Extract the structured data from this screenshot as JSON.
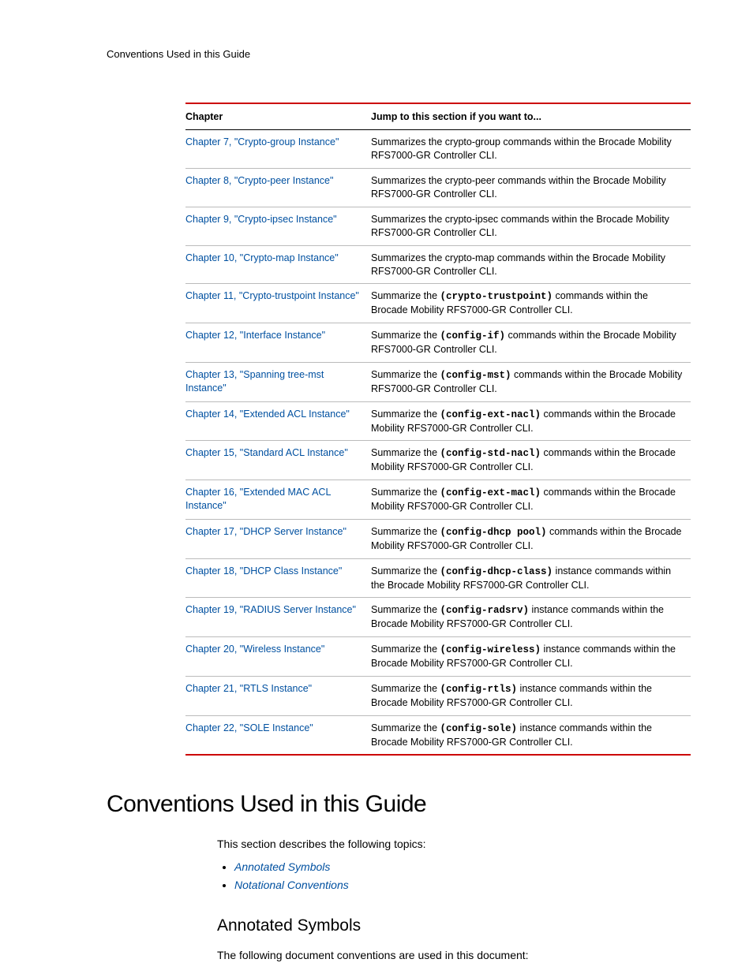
{
  "running_header": "Conventions Used in this Guide",
  "table": {
    "head_chapter": "Chapter",
    "head_desc": "Jump to this section if you want to...",
    "rows": [
      {
        "link": "Chapter 7, \"Crypto-group Instance\"",
        "desc": "Summarizes the crypto-group commands within the Brocade Mobility RFS7000-GR Controller CLI."
      },
      {
        "link": "Chapter 8, \"Crypto-peer Instance\"",
        "desc": "Summarizes the crypto-peer commands within the Brocade Mobility RFS7000-GR Controller CLI."
      },
      {
        "link": "Chapter 9, \"Crypto-ipsec Instance\"",
        "desc": "Summarizes the crypto-ipsec commands within the Brocade Mobility RFS7000-GR Controller CLI."
      },
      {
        "link": "Chapter 10, \"Crypto-map Instance\"",
        "desc": "Summarizes the crypto-map commands within the Brocade Mobility RFS7000-GR Controller CLI."
      },
      {
        "link": "Chapter 11, \"Crypto-trustpoint Instance\"",
        "pre": "Summarize the ",
        "code": "(crypto-trustpoint)",
        "post": " commands within the Brocade Mobility RFS7000-GR Controller CLI."
      },
      {
        "link": "Chapter 12, \"Interface Instance\"",
        "pre": "Summarize the ",
        "code": "(config-if)",
        "post": " commands within the Brocade Mobility RFS7000-GR Controller CLI."
      },
      {
        "link": "Chapter 13, \"Spanning tree-mst Instance\"",
        "pre": "Summarize the ",
        "code": "(config-mst)",
        "post": " commands within the Brocade Mobility RFS7000-GR Controller CLI."
      },
      {
        "link": "Chapter 14, \"Extended ACL Instance\"",
        "pre": "Summarize the ",
        "code": "(config-ext-nacl)",
        "post": " commands within the Brocade Mobility RFS7000-GR Controller CLI."
      },
      {
        "link": "Chapter 15, \"Standard ACL Instance\"",
        "pre": "Summarize the ",
        "code": "(config-std-nacl)",
        "post": " commands within the Brocade Mobility RFS7000-GR Controller CLI."
      },
      {
        "link": "Chapter 16, \"Extended MAC ACL Instance\"",
        "pre": "Summarize the ",
        "code": "(config-ext-macl)",
        "post": " commands within the Brocade Mobility RFS7000-GR Controller CLI."
      },
      {
        "link": "Chapter 17, \"DHCP Server Instance\"",
        "pre": "Summarize the ",
        "code": "(config-dhcp pool)",
        "post": "  commands within the Brocade Mobility RFS7000-GR Controller CLI."
      },
      {
        "link": "Chapter 18, \"DHCP Class Instance\"",
        "pre": "Summarize the ",
        "code": "(config-dhcp-class)",
        "post": " instance commands within the Brocade Mobility RFS7000-GR Controller CLI."
      },
      {
        "link": "Chapter 19, \"RADIUS Server Instance\"",
        "pre": "Summarize the ",
        "code": "(config-radsrv)",
        "post": "  instance commands within the Brocade Mobility RFS7000-GR Controller CLI."
      },
      {
        "link": "Chapter 20, \"Wireless Instance\"",
        "pre": "Summarize the ",
        "code": "(config-wireless)",
        "post": "  instance commands within the Brocade Mobility RFS7000-GR Controller CLI."
      },
      {
        "link": "Chapter 21, \"RTLS Instance\"",
        "pre": "Summarize the ",
        "code": "(config-rtls)",
        "post": "  instance commands within the Brocade Mobility RFS7000-GR Controller CLI."
      },
      {
        "link": "Chapter 22, \"SOLE Instance\"",
        "pre": "Summarize the ",
        "code": "(config-sole)",
        "post": "  instance commands within the Brocade Mobility RFS7000-GR Controller CLI."
      }
    ]
  },
  "section_title": "Conventions Used in this Guide",
  "section_intro": "This section describes the following topics:",
  "topic_links": [
    "Annotated Symbols",
    "Notational Conventions"
  ],
  "subsection_title": "Annotated Symbols",
  "subsection_body": "The following document conventions are used in this document:"
}
